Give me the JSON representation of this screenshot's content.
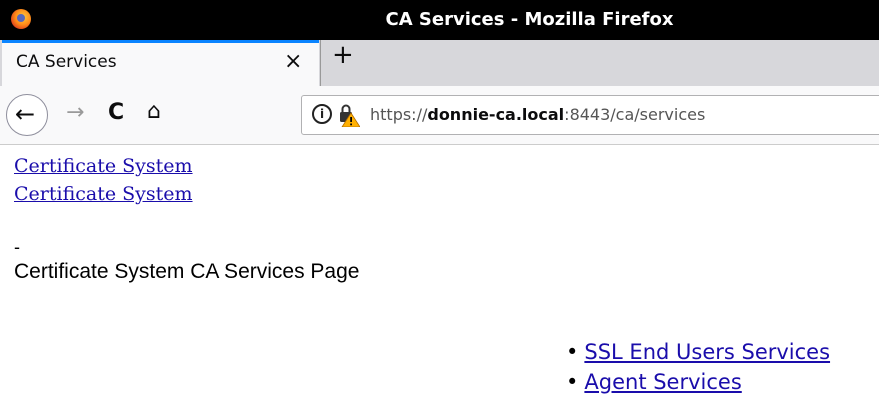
{
  "window": {
    "title": "CA Services - Mozilla Firefox"
  },
  "tabs": [
    {
      "label": "CA Services",
      "close": "×"
    }
  ],
  "toolbar": {
    "new_tab": "+",
    "back": "←",
    "forward": "→",
    "reload": "C",
    "home": "⌂"
  },
  "urlbar": {
    "info": "i",
    "scheme": "https://",
    "host": "donnie-ca.local",
    "rest": ":8443/ca/services",
    "icons": [
      "info-icon",
      "insecure-lock-warning-icon"
    ]
  },
  "page": {
    "links": [
      "Certificate System",
      "Certificate System"
    ],
    "dash": "-",
    "heading": "Certificate System CA Services Page",
    "services": [
      "SSL End Users Services",
      "Agent Services"
    ]
  },
  "colors": {
    "link": "#1a0dab",
    "tab_accent": "#0a84ff",
    "titlebar": "#000000"
  }
}
